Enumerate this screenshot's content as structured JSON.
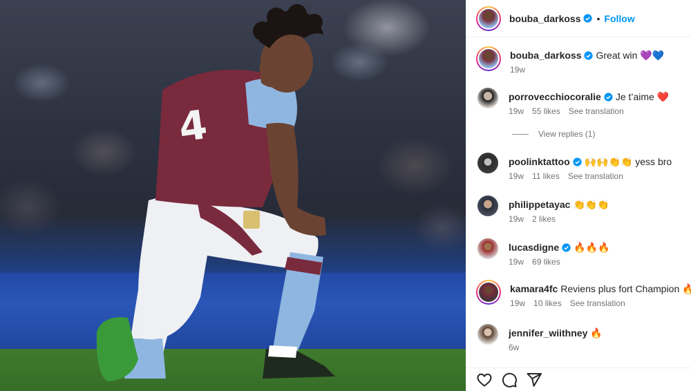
{
  "post_author": {
    "username": "bouba_darkoss",
    "separator": "•",
    "follow_label": "Follow"
  },
  "caption": {
    "username": "bouba_darkoss",
    "text": "Great win 💜💙",
    "time": "19w"
  },
  "comments": [
    {
      "username": "porrovecchiocoralie",
      "verified": true,
      "text": "Je t’aime ❤️",
      "time": "19w",
      "likes": "55 likes",
      "translate": "See translation"
    },
    {
      "username": "poolinktattoo",
      "verified": true,
      "text": "🙌🙌👏👏 yess bro",
      "time": "19w",
      "likes": "11 likes",
      "translate": "See translation"
    },
    {
      "username": "philippetayac",
      "verified": false,
      "text": "👏👏👏",
      "time": "19w",
      "likes": "2 likes",
      "translate": ""
    },
    {
      "username": "lucasdigne",
      "verified": true,
      "text": "🔥🔥🔥",
      "time": "19w",
      "likes": "69 likes",
      "translate": ""
    },
    {
      "username": "kamara4fc",
      "verified": false,
      "text": "Reviens plus fort Champion 🔥",
      "time": "19w",
      "likes": "10 likes",
      "translate": "See translation"
    },
    {
      "username": "jennifer_wiithney",
      "verified": false,
      "text": "🔥",
      "time": "6w",
      "likes": "",
      "translate": ""
    }
  ],
  "view_replies_label": "View replies (1)",
  "actions": {
    "like": "heart-icon",
    "comment": "comment-icon",
    "share": "share-icon"
  },
  "colors": {
    "accent": "#0095f6",
    "verified": "#0095f6",
    "kit_claret": "#7a2a3d",
    "kit_blue": "#8fb6e0"
  }
}
